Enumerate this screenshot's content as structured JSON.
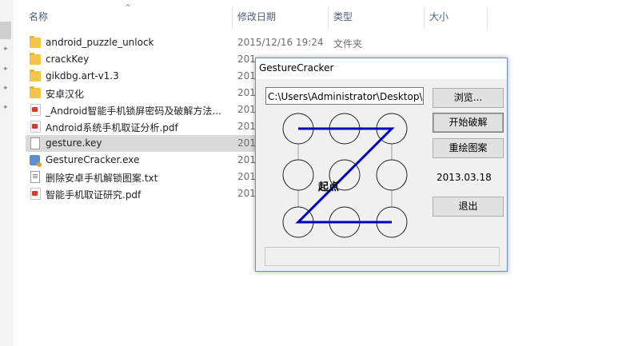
{
  "explorer": {
    "columns": {
      "name": "名称",
      "date": "修改日期",
      "type": "类型",
      "size": "大小"
    },
    "rows": [
      {
        "name": "android_puzzle_unlock",
        "date": "2015/12/16 19:24",
        "type": "文件夹",
        "icon": "folder-icon"
      },
      {
        "name": "crackKey",
        "date": "201",
        "type": "",
        "icon": "folder-icon"
      },
      {
        "name": "gikdbg.art-v1.3",
        "date": "201",
        "type": "",
        "icon": "folder-icon"
      },
      {
        "name": "安卓汉化",
        "date": "201",
        "type": "",
        "icon": "folder-icon"
      },
      {
        "name": "_Android智能手机锁屏密码及破解方法...",
        "date": "201",
        "type": "",
        "icon": "pdf-icon"
      },
      {
        "name": "Android系统手机取证分析.pdf",
        "date": "201",
        "type": "",
        "icon": "pdf-icon"
      },
      {
        "name": "gesture.key",
        "date": "201",
        "type": "",
        "icon": "file-icon"
      },
      {
        "name": "GestureCracker.exe",
        "date": "201",
        "type": "",
        "icon": "exe-icon"
      },
      {
        "name": "删除安卓手机解锁图案.txt",
        "date": "201",
        "type": "",
        "icon": "txt-icon"
      },
      {
        "name": "智能手机取证研究.pdf",
        "date": "201",
        "type": "",
        "icon": "pdf-icon"
      }
    ],
    "selected_row": "gesture.key"
  },
  "cracker": {
    "title": "GestureCracker",
    "path_value": "C:\\Users\\Administrator\\Desktop\\密码",
    "browse_label": "浏览...",
    "start_label": "开始破解",
    "redraw_label": "重绘图案",
    "date": "2013.03.18",
    "exit_label": "退出",
    "pattern_start_label": "起点",
    "pattern_sequence": [
      0,
      2,
      6,
      8
    ],
    "pattern_color": "#0000c0",
    "status_text": ""
  }
}
